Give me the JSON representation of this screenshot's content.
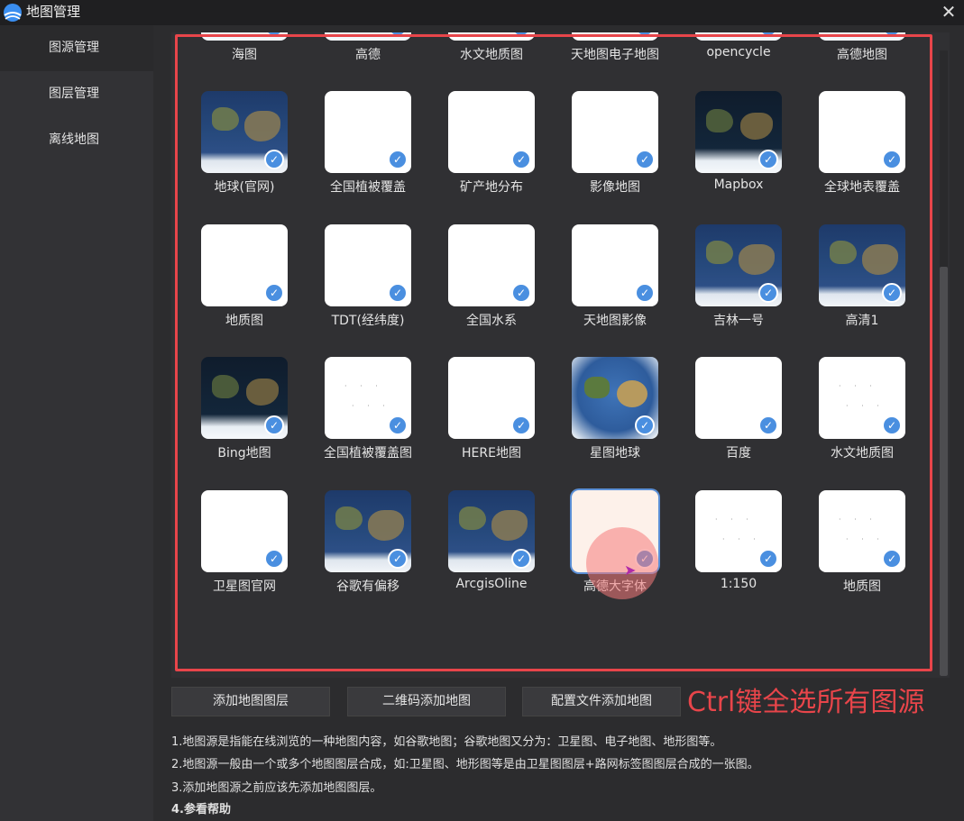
{
  "window": {
    "title": "地图管理",
    "close_label": "✕"
  },
  "sidebar": {
    "items": [
      {
        "label": "图源管理",
        "active": true
      },
      {
        "label": "图层管理",
        "active": false
      },
      {
        "label": "离线地图",
        "active": false
      }
    ]
  },
  "grid": {
    "rows": [
      [
        {
          "label": "海图",
          "thumb": "map-light"
        },
        {
          "label": "高德",
          "thumb": "map-light"
        },
        {
          "label": "水文地质图",
          "thumb": "blank"
        },
        {
          "label": "天地图电子地图",
          "thumb": "blank"
        },
        {
          "label": "opencycle",
          "thumb": "map-light"
        },
        {
          "label": "高德地图",
          "thumb": "map-light"
        }
      ],
      [
        {
          "label": "地球(官网)",
          "thumb": "map-world"
        },
        {
          "label": "全国植被覆盖",
          "thumb": "blank"
        },
        {
          "label": "矿产地分布",
          "thumb": "blank"
        },
        {
          "label": "影像地图",
          "thumb": "blank"
        },
        {
          "label": "Mapbox",
          "thumb": "map-dark"
        },
        {
          "label": "全球地表覆盖",
          "thumb": "blank"
        }
      ],
      [
        {
          "label": "地质图",
          "thumb": "blank"
        },
        {
          "label": "TDT(经纬度)",
          "thumb": "blank"
        },
        {
          "label": "全国水系",
          "thumb": "blank"
        },
        {
          "label": "天地图影像",
          "thumb": "blank"
        },
        {
          "label": "吉林一号",
          "thumb": "map-world"
        },
        {
          "label": "高清1",
          "thumb": "map-world"
        }
      ],
      [
        {
          "label": "Bing地图",
          "thumb": "map-dark"
        },
        {
          "label": "全国植被覆盖图",
          "thumb": "map-dots"
        },
        {
          "label": "HERE地图",
          "thumb": "blank"
        },
        {
          "label": "星图地球",
          "thumb": "map-star"
        },
        {
          "label": "百度",
          "thumb": "blank"
        },
        {
          "label": "水文地质图",
          "thumb": "map-dots"
        }
      ],
      [
        {
          "label": "卫星图官网",
          "thumb": "blank"
        },
        {
          "label": "谷歌有偏移",
          "thumb": "map-world"
        },
        {
          "label": "ArcgisOline",
          "thumb": "map-world"
        },
        {
          "label": "高德大字体",
          "thumb": "map-peach",
          "selected": true
        },
        {
          "label": "1:150",
          "thumb": "map-dots"
        },
        {
          "label": "地质图",
          "thumb": "map-dots"
        }
      ]
    ]
  },
  "check_glyph": "✓",
  "buttons": {
    "add_layer": "添加地图图层",
    "qr_add": "二维码添加地图",
    "config_add": "配置文件添加地图"
  },
  "annotation": {
    "text": "Ctrl键全选所有图源",
    "color": "#e8454a"
  },
  "help": {
    "line1": "1.地图源是指能在线浏览的一种地图内容，如谷歌地图；谷歌地图又分为：卫星图、电子地图、地形图等。",
    "line2": "2.地图源一般由一个或多个地图图层合成，如:卫星图、地形图等是由卫星图图层+路网标签图图层合成的一张图。",
    "line3": "3.添加地图源之前应该先添加地图图层。",
    "line4": "4.参看帮助"
  },
  "colors": {
    "accent": "#4a8fe0",
    "highlight": "#e8454a",
    "background": "#2c2c2e"
  }
}
